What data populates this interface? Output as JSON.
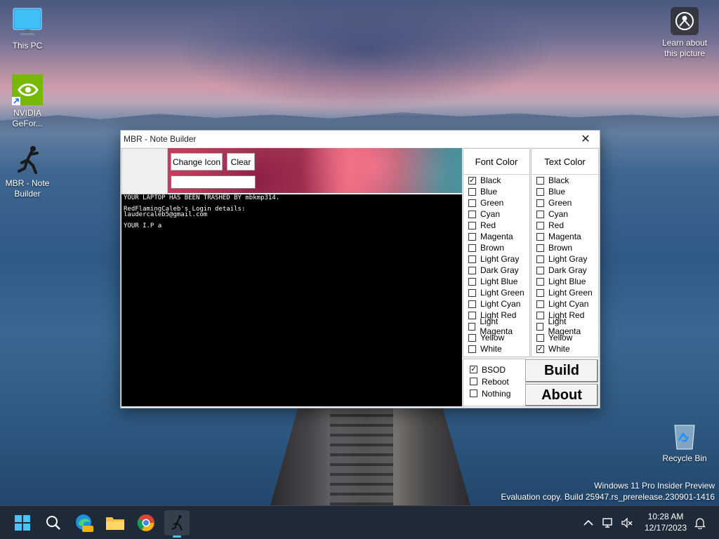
{
  "desktop": {
    "icons": [
      {
        "label": "This PC"
      },
      {
        "label": "NVIDIA GeFor..."
      },
      {
        "label": "MBR - Note Builder"
      },
      {
        "label": "Learn about this picture"
      },
      {
        "label": "Recycle Bin"
      }
    ],
    "watermark": {
      "line1": "Windows 11 Pro Insider Preview",
      "line2": "Evaluation copy. Build 25947.rs_prerelease.230901-1416"
    }
  },
  "window": {
    "title": "MBR - Note Builder",
    "close_glyph": "✕",
    "change_icon_label": "Change Icon",
    "clear_label": "Clear",
    "icon_path_value": "",
    "console_lines": [
      "YOUR LAPTOP HAS BEEN TRASHED BY mbkmp314.",
      "",
      "RedFlamingCaleb's Login details:",
      "laudercaleb5@gmail.com",
      "",
      "YOUR I.P a"
    ],
    "font_color": {
      "title": "Font Color",
      "options": [
        "Black",
        "Blue",
        "Green",
        "Cyan",
        "Red",
        "Magenta",
        "Brown",
        "Light Gray",
        "Dark Gray",
        "Light Blue",
        "Light Green",
        "Light Cyan",
        "Light Red",
        "Light Magenta",
        "Yellow",
        "White"
      ],
      "checked": "Black"
    },
    "text_color": {
      "title": "Text Color",
      "options": [
        "Black",
        "Blue",
        "Green",
        "Cyan",
        "Red",
        "Magenta",
        "Brown",
        "Light Gray",
        "Dark Gray",
        "Light Blue",
        "Light Green",
        "Light Cyan",
        "Light Red",
        "Light Magenta",
        "Yellow",
        "White"
      ],
      "checked": "White"
    },
    "actions": [
      {
        "label": "BSOD",
        "checked": true
      },
      {
        "label": "Reboot",
        "checked": false
      },
      {
        "label": "Nothing",
        "checked": false
      }
    ],
    "build_label": "Build",
    "about_label": "About"
  },
  "taskbar": {
    "apps": [
      "start-icon",
      "search-icon",
      "edge-icon",
      "file-explorer-icon",
      "chrome-icon",
      "mbr-note-builder-icon"
    ],
    "time": "10:28 AM",
    "date": "12/17/2023"
  }
}
